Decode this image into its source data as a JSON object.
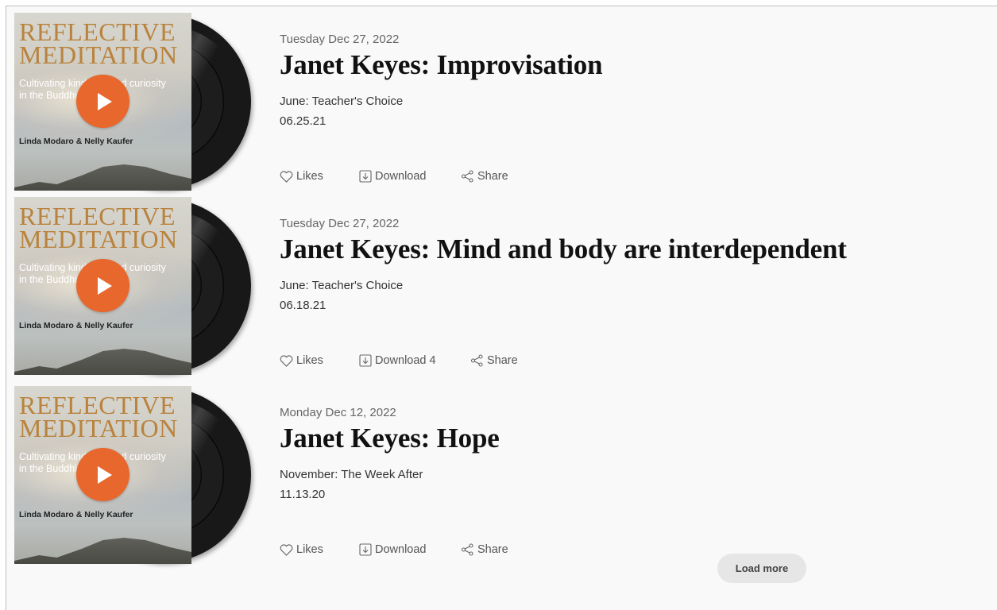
{
  "cover": {
    "title_line1": "REFLECTIVE",
    "title_line2": "MEDITATION",
    "subtitle_line1": "Cultivating kindness and curiosity",
    "subtitle_line2": "in the Buddhist way",
    "authors": "Linda Modaro & Nelly Kaufer"
  },
  "colors": {
    "play_button": "#e8672d",
    "cover_title": "#b9833d",
    "load_more_bg": "#e6e6e6"
  },
  "episodes": [
    {
      "date": "Tuesday Dec 27, 2022",
      "title": "Janet Keyes: Improvisation",
      "category": "June: Teacher's Choice",
      "code": "06.25.21",
      "likes_label": "Likes",
      "download_label": "Download",
      "share_label": "Share"
    },
    {
      "date": "Tuesday Dec 27, 2022",
      "title": "Janet Keyes: Mind and body are interdependent",
      "category": "June: Teacher's Choice",
      "code": "06.18.21",
      "likes_label": "Likes",
      "download_label": "Download 4",
      "share_label": "Share"
    },
    {
      "date": "Monday Dec 12, 2022",
      "title": "Janet Keyes: Hope",
      "category": "November: The Week After",
      "code": "11.13.20",
      "likes_label": "Likes",
      "download_label": "Download",
      "share_label": "Share"
    }
  ],
  "load_more_label": "Load more",
  "icons": {
    "like": "heart-icon",
    "download": "download-icon",
    "share": "share-icon",
    "play": "play-icon"
  }
}
